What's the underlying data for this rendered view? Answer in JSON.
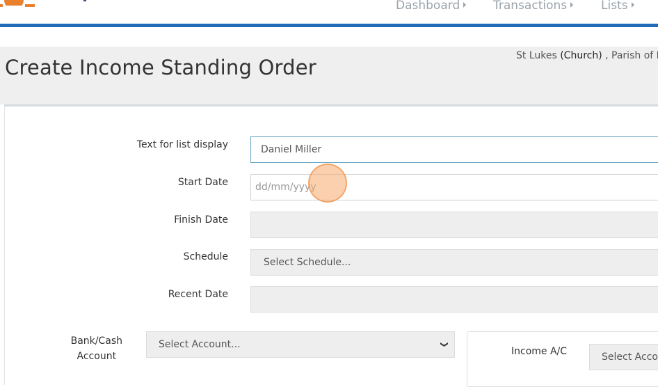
{
  "nav": {
    "items": [
      {
        "label": "Dashboard"
      },
      {
        "label": "Transactions"
      },
      {
        "label": "Lists"
      }
    ]
  },
  "header": {
    "title": "Create Income Standing Order",
    "location_prefix": "St Lukes ",
    "location_strong": "(Church)",
    "location_suffix": " , Parish of D"
  },
  "form": {
    "text_for_list_display": {
      "label": "Text for list display",
      "value": "Daniel Miller"
    },
    "start_date": {
      "label": "Start Date",
      "placeholder": "dd/mm/yyyy",
      "value": ""
    },
    "finish_date": {
      "label": "Finish Date",
      "value": ""
    },
    "schedule": {
      "label": "Schedule",
      "selected": "Select Schedule..."
    },
    "recent_date": {
      "label": "Recent Date",
      "value": ""
    },
    "bank_cash_account": {
      "label_line1": "Bank/Cash",
      "label_line2": "Account",
      "selected": "Select Account..."
    },
    "income_ac": {
      "label": "Income A/C",
      "selected": "Select Accou"
    }
  },
  "colors": {
    "accent": "#1f6bb8",
    "nav_text": "#9aa3ab",
    "header_bg": "#efefef",
    "cursor_highlight": "#f5aa6e"
  }
}
